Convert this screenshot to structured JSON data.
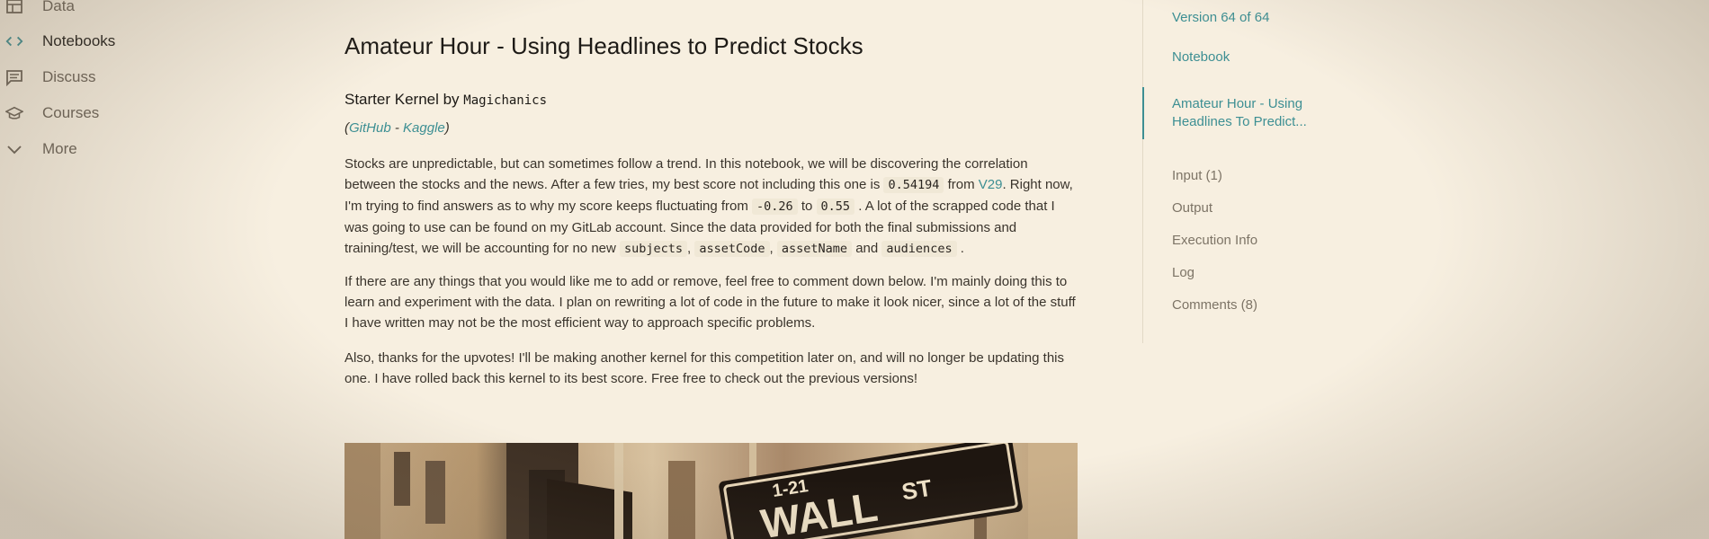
{
  "nav": {
    "items": [
      {
        "label": "Data",
        "icon": "table-icon"
      },
      {
        "label": "Notebooks",
        "icon": "code-icon"
      },
      {
        "label": "Discuss",
        "icon": "discussion-icon"
      },
      {
        "label": "Courses",
        "icon": "graduation-cap-icon"
      },
      {
        "label": "More",
        "icon": "chevron-down-icon"
      }
    ],
    "active": "Notebooks"
  },
  "notebook": {
    "title": "Amateur Hour - Using Headlines to Predict Stocks",
    "starter_prefix": "Starter Kernel by",
    "author": "Magichanics",
    "links": {
      "open_paren": "(",
      "github": "GitHub",
      "separator": " - ",
      "kaggle": "Kaggle",
      "close_paren": ")"
    },
    "paragraph1": {
      "t1": "Stocks are unpredictable, but can sometimes follow a trend. In this notebook, we will be discovering the correlation between the stocks and the news. After a few tries, my best score not including this one is",
      "score": "0.54194",
      "t2": "from",
      "version_link": "V29",
      "t3": ". Right now, I'm trying to find answers as to why my score keeps fluctuating from",
      "low": "-0.26",
      "t4": "to",
      "high": "0.55",
      "t5": ". A lot of the scrapped code that I was going to use can be found on my GitLab account. Since the data provided for both the final submissions and training/test, we will be accounting for no new",
      "c1": "subjects",
      "sep1": ",",
      "c2": "assetCode",
      "sep2": ",",
      "c3": "assetName",
      "and": "and",
      "c4": "audiences",
      "end": "."
    },
    "paragraph2": "If there are any things that you would like me to add or remove, feel free to comment down below. I'm mainly doing this to learn and experiment with the data. I plan on rewriting a lot of code in the future to make it look nicer, since a lot of the stuff I have written may not be the most efficient way to approach specific problems.",
    "paragraph3": "Also, thanks for the upvotes! I'll be making another kernel for this competition later on, and will no longer be updating this one. I have rolled back this kernel to its best score. Free free to check out the previous versions!",
    "image": {
      "sign_number": "1-21",
      "sign_text": "WALL",
      "sign_suffix": "ST"
    }
  },
  "toc": {
    "version": "Version 64 of 64",
    "notebook": "Notebook",
    "active_section": "Amateur Hour - Using Headlines To Predict...",
    "items": [
      "Input (1)",
      "Output",
      "Execution Info",
      "Log",
      "Comments (8)"
    ]
  },
  "colors": {
    "accent": "#3d8f93",
    "background": "#f7efe0",
    "text": "#3a342c"
  }
}
